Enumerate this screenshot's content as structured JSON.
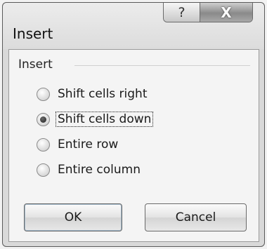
{
  "window": {
    "title": "Insert",
    "help_glyph": "?",
    "close_glyph": "X"
  },
  "group": {
    "label": "Insert"
  },
  "options": [
    {
      "label": "Shift cells right",
      "selected": false
    },
    {
      "label": "Shift cells down",
      "selected": true
    },
    {
      "label": "Entire row",
      "selected": false
    },
    {
      "label": "Entire column",
      "selected": false
    }
  ],
  "buttons": {
    "ok": "OK",
    "cancel": "Cancel"
  }
}
